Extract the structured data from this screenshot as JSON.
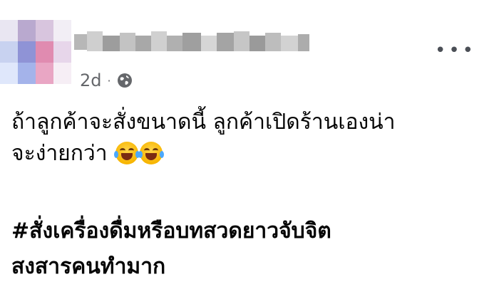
{
  "post": {
    "timestamp": "2d",
    "separator": "·",
    "privacy_icon": "globe-icon",
    "more_icon": "more-horizontal-icon",
    "body_line1": "ถ้าลูกค้าจะสั่งขนาดนี้ ลูกค้าเปิดร้านเองน่า",
    "body_line2": "จะง่ายกว่า",
    "emojis": [
      "face-with-tears-of-joy",
      "face-with-tears-of-joy"
    ],
    "hashtag_line1": "#สั่งเครื่องดื่มหรือบทสวดยาวจับจิต",
    "hashtag_line2": "สงสารคนทำมาก"
  }
}
